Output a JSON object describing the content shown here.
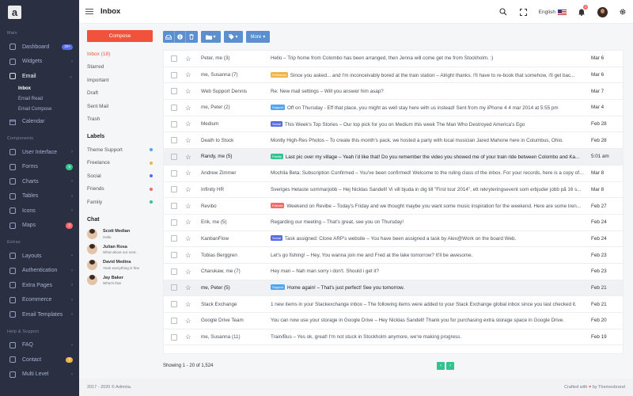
{
  "brand": {
    "logo_letter": "a"
  },
  "colors": {
    "accent": "#556ee6",
    "compose": "#f1523c",
    "sidebar_bg": "#2a3042",
    "success": "#34c38f",
    "danger": "#f46a6a"
  },
  "sidebar": {
    "section_main": "Main",
    "main_items": [
      {
        "label": "Dashboard",
        "icon": "dashboard-icon",
        "badge": "20+",
        "badge_color": "#556ee6"
      },
      {
        "label": "Widgets",
        "icon": "widgets-icon"
      },
      {
        "label": "Email",
        "icon": "email-icon",
        "expanded": true
      }
    ],
    "email_sub": [
      "Inbox",
      "Email Read",
      "Email Compose"
    ],
    "calendar": {
      "label": "Calendar",
      "icon": "calendar-icon"
    },
    "section_components": "Components",
    "components_items": [
      {
        "label": "User Interface",
        "icon": "user-interface-icon"
      },
      {
        "label": "Forms",
        "icon": "forms-icon",
        "badge": "9",
        "badge_color": "#34c38f"
      },
      {
        "label": "Charts",
        "icon": "charts-icon"
      },
      {
        "label": "Tables",
        "icon": "tables-icon"
      },
      {
        "label": "Icons",
        "icon": "icons-icon"
      },
      {
        "label": "Maps",
        "icon": "maps-icon",
        "badge": "2",
        "badge_color": "#f46a6a"
      }
    ],
    "section_extras": "Extras",
    "extras_items": [
      {
        "label": "Layouts",
        "icon": "layouts-icon"
      },
      {
        "label": "Authentication",
        "icon": "authentication-icon"
      },
      {
        "label": "Extra Pages",
        "icon": "extra-pages-icon"
      },
      {
        "label": "Ecommerce",
        "icon": "ecommerce-icon"
      },
      {
        "label": "Email Templates",
        "icon": "email-templates-icon"
      }
    ],
    "section_help": "Help & Support",
    "help_items": [
      {
        "label": "FAQ",
        "icon": "faq-icon"
      },
      {
        "label": "Contact",
        "icon": "contact-icon",
        "badge": "3",
        "badge_color": "#f1b44c"
      },
      {
        "label": "Multi Level",
        "icon": "multi-level-icon"
      }
    ]
  },
  "topbar": {
    "title": "Inbox",
    "language": "English",
    "notification_count": "3"
  },
  "leftpanel": {
    "compose_label": "Compose",
    "folders": [
      "Inbox (18)",
      "Starred",
      "Important",
      "Draft",
      "Sent Mail",
      "Trash"
    ],
    "labels_title": "Labels",
    "labels": [
      {
        "name": "Theme Support",
        "color": "#50a5f1"
      },
      {
        "name": "Freelance",
        "color": "#f1b44c"
      },
      {
        "name": "Social",
        "color": "#556ee6"
      },
      {
        "name": "Friends",
        "color": "#f46a6a"
      },
      {
        "name": "Family",
        "color": "#34c38f"
      }
    ],
    "chat_title": "Chat",
    "chats": [
      {
        "name": "Scott Median",
        "message": "Hello"
      },
      {
        "name": "Julian Rosa",
        "message": "What about our next.."
      },
      {
        "name": "David Medina",
        "message": "Yeah everything is fine"
      },
      {
        "name": "Jay Baker",
        "message": "What's that"
      }
    ]
  },
  "toolbar": {
    "more_label": "More"
  },
  "emails": [
    {
      "sender": "Peter, me (3)",
      "tag": "",
      "tag_color": "",
      "subject": "Hello – Trip home from Colombo has been arranged, then Jenna will come get me from Stockholm. :)",
      "date": "Mar 6"
    },
    {
      "sender": "me, Susanna (7)",
      "tag": "Freelance",
      "tag_color": "#f1b44c",
      "subject": "Since you asked... and I'm inconceivably bored at the train station – Alright thanks. I'll have to re-book that somehow, i'll get bac...",
      "date": "Mar 6"
    },
    {
      "sender": "Web Support Dennis",
      "tag": "",
      "tag_color": "",
      "subject": "Re: New mail settings – Will you answer him asap?",
      "date": "Mar 7"
    },
    {
      "sender": "me, Peter (2)",
      "tag": "Support",
      "tag_color": "#50a5f1",
      "subject": "Off on Thursday - Eff that place, you might as well stay here with us instead! Sent from my iPhone 4 4 mar 2014 at 5:55 pm",
      "date": "Mar 4"
    },
    {
      "sender": "Medium",
      "tag": "Social",
      "tag_color": "#556ee6",
      "subject": "This Week's Top Stories – Our top pick for you on Medium this week The Man Who Destroyed America's Ego",
      "date": "Feb 28"
    },
    {
      "sender": "Death to Stock",
      "tag": "",
      "tag_color": "",
      "subject": "Montly High-Res Photos – To create this month's pack, we hosted a party with local musician Jared Mahone here in Columbus, Ohio.",
      "date": "Feb 28"
    },
    {
      "sender": "Randy, me (5)",
      "tag": "Family",
      "tag_color": "#34c38f",
      "subject": "Last pic over my village – Yeah i'd like that! Do you remember the video you showed me of your train ride between Colombo and Ka...",
      "date": "5:01 am",
      "highlight": true
    },
    {
      "sender": "Andrew Zimmer",
      "tag": "",
      "tag_color": "",
      "subject": "Mochila Beta: Subscription Confirmed – You've been confirmed! Welcome to the ruling class of the inbox. For your records, here is a copy of...",
      "date": "Mar 8"
    },
    {
      "sender": "Infinity HR",
      "tag": "",
      "tag_color": "",
      "subject": "Sveriges Hetaste sommarjobb – Hej Nicklas Sandell! Vi vill bjuda in dig till \"First tour 2014\", ett rekryteringsevent som erbjuder jobb på 16 s...",
      "date": "Mar 8"
    },
    {
      "sender": "Revibo",
      "tag": "Friends",
      "tag_color": "#f46a6a",
      "subject": "Weekend on Revibe – Today's Friday and we thought maybe you want some music inspiration for the weekend. Here are some tren...",
      "date": "Feb 27"
    },
    {
      "sender": "Erik, me (5)",
      "tag": "",
      "tag_color": "",
      "subject": "Regarding our meeting – That's great, see you on Thursday!",
      "date": "Feb 24"
    },
    {
      "sender": "KanbanFlow",
      "tag": "Social",
      "tag_color": "#556ee6",
      "subject": "Task assigned: Clone ARP's website – You have been assigned a task by Alex@Work on the board Web.",
      "date": "Feb 24"
    },
    {
      "sender": "Tobias Berggren",
      "tag": "",
      "tag_color": "",
      "subject": "Let's go fishing! – Hey, You wanna join me and Fred at the lake tomorrow? It'll be awesome.",
      "date": "Feb 23"
    },
    {
      "sender": "Charukaw, me (7)",
      "tag": "",
      "tag_color": "",
      "subject": "Hey man – Nah man sorry i don't. Should i get it?",
      "date": "Feb 23"
    },
    {
      "sender": "me, Peter (5)",
      "tag": "Support",
      "tag_color": "#50a5f1",
      "subject": "Home again! – That's just perfect! See you tomorrow.",
      "date": "Feb 21",
      "highlight": true
    },
    {
      "sender": "Stack Exchange",
      "tag": "",
      "tag_color": "",
      "subject": "1 new items in your Stackexchange inbox – The following items were added to your Stack Exchange global inbox since you last checked it.",
      "date": "Feb 21"
    },
    {
      "sender": "Google Drive Team",
      "tag": "",
      "tag_color": "",
      "subject": "You can now use your storage in Google Drive – Hey Nicklas Sandell! Thank you for purchasing extra storage space in Google Drive.",
      "date": "Feb 20"
    },
    {
      "sender": "me, Susanna (11)",
      "tag": "",
      "tag_color": "",
      "subject": "Train/Bus – Yes ok, great! I'm not stuck in Stockholm anymore, we're making progress.",
      "date": "Feb 19"
    }
  ],
  "pagination": {
    "summary": "Showing 1 - 20 of 1,524"
  },
  "footer": {
    "copyright": "2017 - 2020 © Admiria.",
    "credit_prefix": "Crafted with",
    "credit_suffix": "by Themesbrand"
  }
}
